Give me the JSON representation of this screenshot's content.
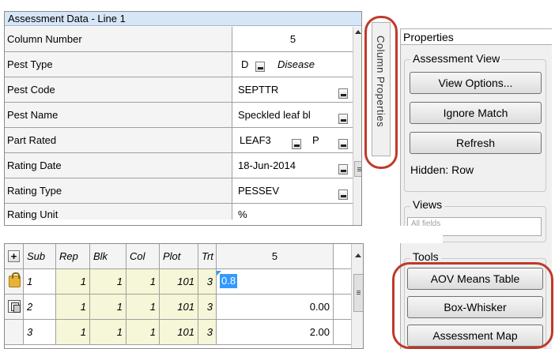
{
  "assessment": {
    "title": "Assessment Data - Line 1",
    "rows": [
      {
        "label": "Column Number",
        "value": "5"
      },
      {
        "label": "Pest Type",
        "code": "D",
        "value": "Disease"
      },
      {
        "label": "Pest Code",
        "value": "SEPTTR"
      },
      {
        "label": "Pest Name",
        "value": "Speckled leaf bl"
      },
      {
        "label": "Part Rated",
        "value": "LEAF3",
        "extra": "P"
      },
      {
        "label": "Rating Date",
        "value": "18-Jun-2014"
      },
      {
        "label": "Rating Type",
        "value": "PESSEV"
      },
      {
        "label": "Rating Unit",
        "value": "%"
      }
    ]
  },
  "column_properties_tab": "Column Properties",
  "properties": {
    "title": "Properties",
    "assessment_view": {
      "label": "Assessment View",
      "buttons": [
        "View Options...",
        "Ignore Match",
        "Refresh"
      ],
      "hidden_text": "Hidden: Row"
    },
    "views": {
      "label": "Views",
      "select_value": "All fields"
    },
    "tools": {
      "label": "Tools",
      "buttons": [
        "AOV Means Table",
        "Box-Whisker",
        "Assessment Map"
      ]
    }
  },
  "grid": {
    "plus": "+",
    "headers": [
      "Sub",
      "Rep",
      "Blk",
      "Col",
      "Plot",
      "Trt",
      "5"
    ],
    "rows": [
      {
        "sub": "1",
        "rep": "1",
        "blk": "1",
        "col": "1",
        "plot": "101",
        "trt": "3",
        "value": "0.8"
      },
      {
        "sub": "2",
        "rep": "1",
        "blk": "1",
        "col": "1",
        "plot": "101",
        "trt": "3",
        "value": "0.00"
      },
      {
        "sub": "3",
        "rep": "1",
        "blk": "1",
        "col": "1",
        "plot": "101",
        "trt": "3",
        "value": "2.00"
      }
    ]
  },
  "colors": {
    "title_bar": "#d6e6f7",
    "highlight_circle": "#c0392b",
    "selection": "#3399ff",
    "plot_cell_bg": "#f6f6d8"
  }
}
